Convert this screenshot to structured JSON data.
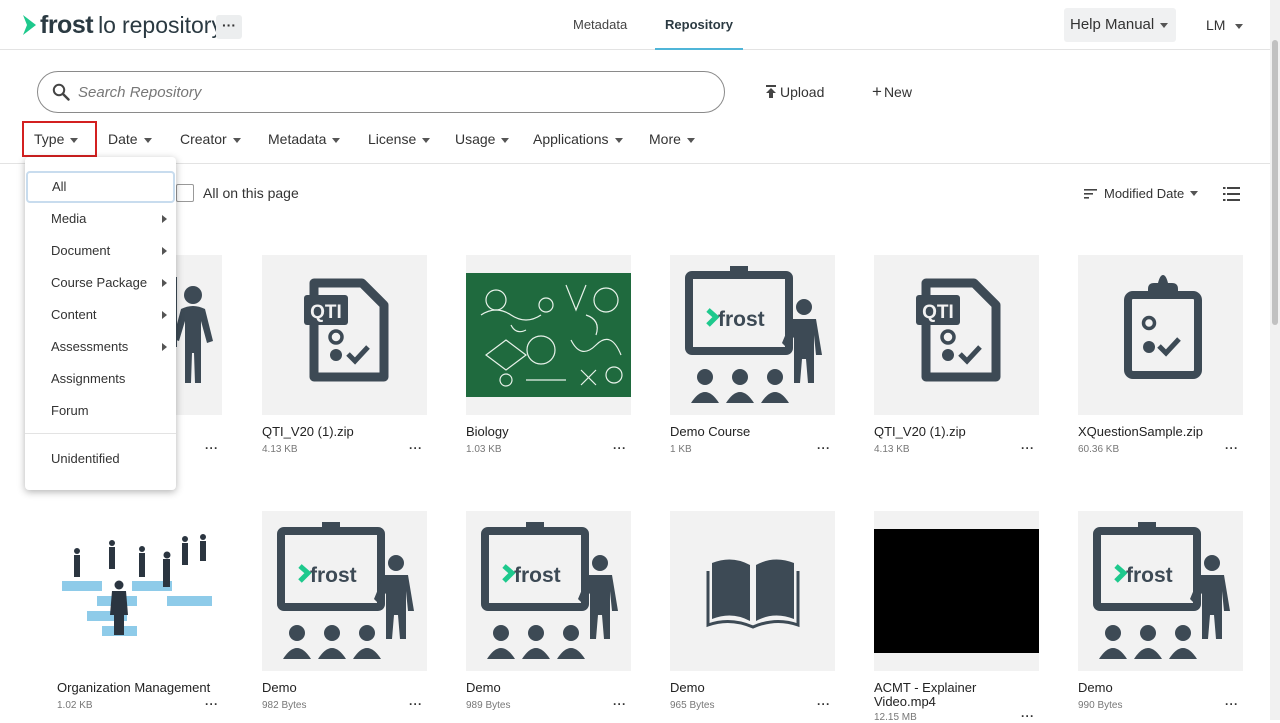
{
  "app": {
    "brand": "frost",
    "brand_lo": "lo",
    "brand_suffix": "repository",
    "more_label": "···",
    "accent": "#1ec98d",
    "dark": "#3d4a55"
  },
  "nav": {
    "tabs": [
      {
        "label": "Metadata"
      },
      {
        "label": "Repository"
      }
    ],
    "help_label": "Help Manual",
    "user_label": "LM"
  },
  "search": {
    "placeholder": "Search Repository"
  },
  "actions": {
    "upload_label": "Upload",
    "new_label": "New"
  },
  "filters": [
    {
      "label": "Type"
    },
    {
      "label": "Date"
    },
    {
      "label": "Creator"
    },
    {
      "label": "Metadata"
    },
    {
      "label": "License"
    },
    {
      "label": "Usage"
    },
    {
      "label": "Applications"
    },
    {
      "label": "More"
    }
  ],
  "select_all": {
    "label": "All on this page"
  },
  "sort": {
    "label": "Modified Date"
  },
  "type_menu": {
    "items": [
      {
        "label": "All"
      },
      {
        "label": "Media"
      },
      {
        "label": "Document"
      },
      {
        "label": "Course Package"
      },
      {
        "label": "Content"
      },
      {
        "label": "Assessments"
      },
      {
        "label": "Assignments"
      },
      {
        "label": "Forum"
      }
    ],
    "unidentified_label": "Unidentified"
  },
  "cards": [
    {
      "title": "QTI_V20 (1).zip",
      "size": "4.13 KB",
      "icon": "qti-document-icon",
      "dots": "···"
    },
    {
      "title": "Biology",
      "size": "1.03 KB",
      "icon": "biology-image",
      "dots": "···"
    },
    {
      "title": "Demo Course",
      "size": "1 KB",
      "icon": "course-presentation-icon",
      "dots": "···"
    },
    {
      "title": "QTI_V20 (1).zip",
      "size": "4.13 KB",
      "icon": "qti-document-icon",
      "dots": "···"
    },
    {
      "title": "XQuestionSample.zip",
      "size": "60.36 KB",
      "icon": "clipboard-quiz-icon",
      "dots": "···"
    },
    {
      "title": "Organization Management",
      "size": "1.02 KB",
      "icon": "organization-image",
      "dots": "···"
    },
    {
      "title": "Demo",
      "size": "982 Bytes",
      "icon": "course-presentation-icon",
      "dots": "···"
    },
    {
      "title": "Demo",
      "size": "989 Bytes",
      "icon": "course-presentation-icon",
      "dots": "···"
    },
    {
      "title": "Demo",
      "size": "965 Bytes",
      "icon": "open-book-icon",
      "dots": "···"
    },
    {
      "title": "ACMT - Explainer Video.mp4",
      "size": "12.15 MB",
      "icon": "video-thumbnail",
      "dots": "···"
    },
    {
      "title": "Demo",
      "size": "990 Bytes",
      "icon": "course-presentation-icon",
      "dots": "···"
    }
  ],
  "partial_card": {
    "dots": "···"
  }
}
